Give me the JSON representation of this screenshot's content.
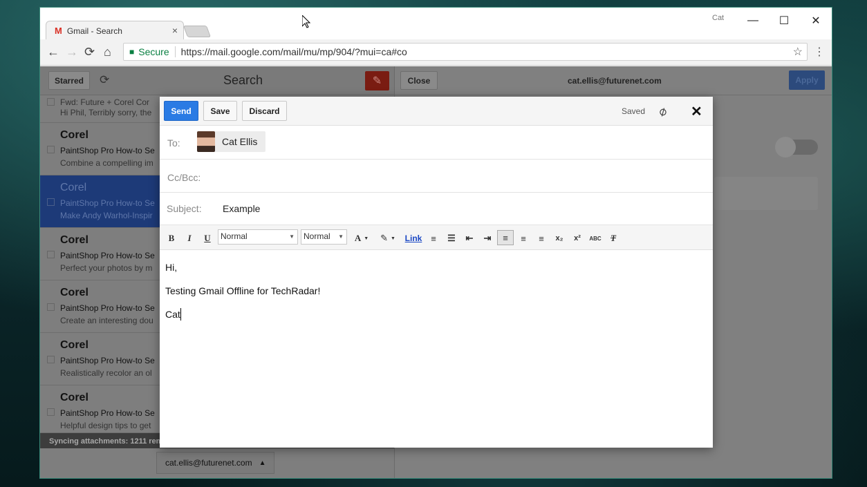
{
  "browser": {
    "tab_title": "Gmail - Search",
    "tab_icon": "M",
    "tab_close": "×",
    "profile_name": "Cat",
    "minimize": "—",
    "maximize": "☐",
    "close": "✕",
    "secure_label": "Secure",
    "url": "https://mail.google.com/mail/mu/mp/904/?mui=ca#co",
    "back": "←",
    "forward": "→",
    "reload": "⟳",
    "home": "⌂",
    "star": "☆",
    "menu": "⋮"
  },
  "left_pane": {
    "starred_label": "Starred",
    "refresh_icon": "⟳",
    "title": "Search",
    "compose_icon": "✎",
    "emails": [
      {
        "sender": "",
        "subject": "Fwd: Future + Corel Cor",
        "snippet": "Hi Phil, Terribly sorry, the"
      },
      {
        "sender": "Corel",
        "subject": "PaintShop Pro How-to Se",
        "snippet": "Combine a compelling im"
      },
      {
        "sender": "Corel",
        "subject": "PaintShop Pro How-to Se",
        "snippet": "Make Andy Warhol-Inspir"
      },
      {
        "sender": "Corel",
        "subject": "PaintShop Pro How-to Se",
        "snippet": "Perfect your photos by m"
      },
      {
        "sender": "Corel",
        "subject": "PaintShop Pro How-to Se",
        "snippet": "Create an interesting dou"
      },
      {
        "sender": "Corel",
        "subject": "PaintShop Pro How-to Se",
        "snippet": "Realistically recolor an ol"
      },
      {
        "sender": "Corel",
        "subject": "PaintShop Pro How-to Se",
        "snippet": "Helpful design tips to get"
      }
    ],
    "sync_status": "Syncing attachments: 1211 rem",
    "account": "cat.ellis@futurenet.com",
    "account_caret": "▲"
  },
  "right_pane": {
    "close_label": "Close",
    "account": "cat.ellis@futurenet.com",
    "apply_label": "Apply"
  },
  "compose": {
    "send_label": "Send",
    "save_label": "Save",
    "discard_label": "Discard",
    "saved_status": "Saved",
    "attach_icon": "📎",
    "close_icon": "✕",
    "to_label": "To:",
    "recipient": "Cat Ellis",
    "cc_label": "Cc/Bcc:",
    "subject_label": "Subject:",
    "subject": "Example",
    "toolbar": {
      "bold": "B",
      "italic": "I",
      "underline": "U",
      "font": "Normal",
      "size": "Normal",
      "text_color": "A",
      "highlight": "✎",
      "link": "Link",
      "numbered_list": "≡",
      "bullet_list": "☰",
      "outdent": "⇤",
      "indent": "⇥",
      "align_left": "≡",
      "align_center": "≡",
      "align_right": "≡",
      "subscript": "x₂",
      "superscript": "x²",
      "spellcheck": "ABC",
      "clear_format": "T"
    },
    "body_lines": [
      "Hi,",
      "Testing Gmail Offline for TechRadar!",
      "Cat"
    ]
  }
}
